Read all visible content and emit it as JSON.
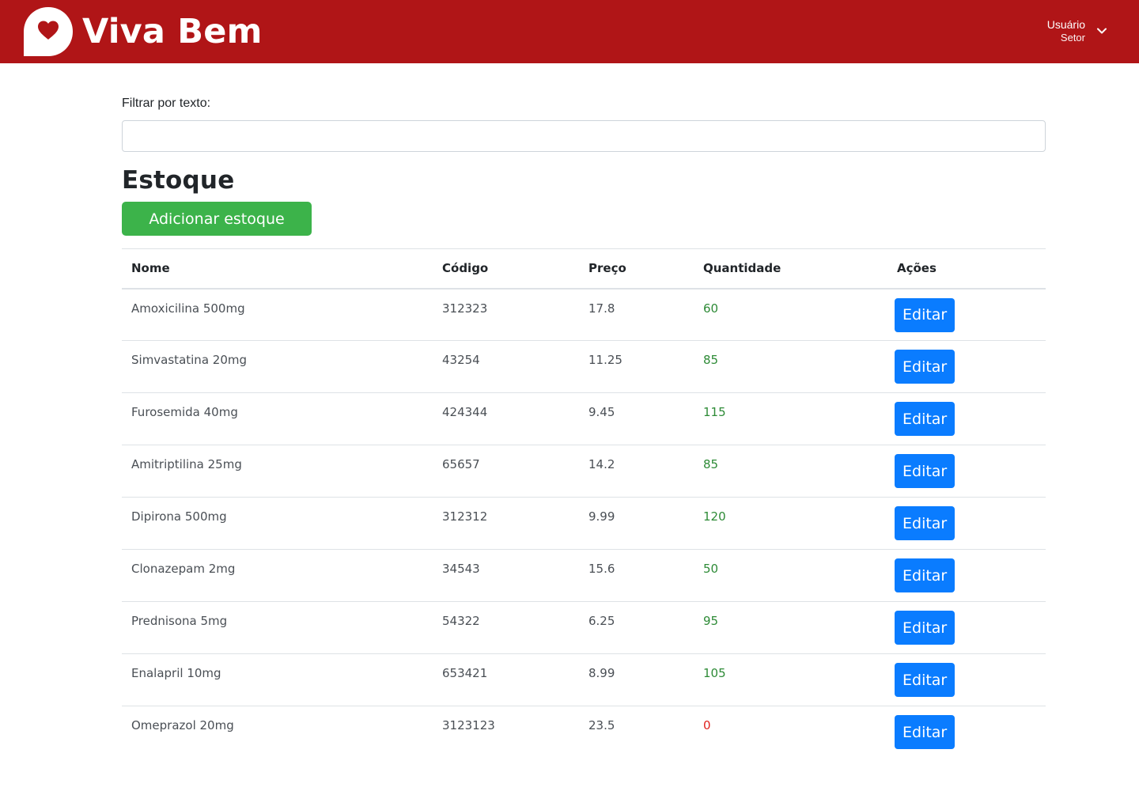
{
  "header": {
    "brand_name": "Viva Bem",
    "logo_icon": "heart-chat-icon",
    "colors": {
      "background": "#b01517",
      "text": "#ffffff"
    },
    "user": {
      "name": "Usuário",
      "sector": "Setor",
      "menu_icon": "chevron-down-icon"
    }
  },
  "filter": {
    "label": "Filtrar por texto:",
    "value": "",
    "placeholder": ""
  },
  "section": {
    "title": "Estoque",
    "add_button_label": "Adicionar estoque",
    "add_button_color": "#3cb34a"
  },
  "table": {
    "columns": [
      "Nome",
      "Código",
      "Preço",
      "Quantidade",
      "Ações"
    ],
    "edit_label": "Editar",
    "colors": {
      "in_stock": "#2e8b37",
      "out_of_stock": "#e0231f",
      "edit_button": "#0a7cff"
    },
    "rows": [
      {
        "nome": "Amoxicilina 500mg",
        "codigo": "312323",
        "preco": "17.8",
        "quantidade": "60"
      },
      {
        "nome": "Simvastatina 20mg",
        "codigo": "43254",
        "preco": "11.25",
        "quantidade": "85"
      },
      {
        "nome": "Furosemida 40mg",
        "codigo": "424344",
        "preco": "9.45",
        "quantidade": "115"
      },
      {
        "nome": "Amitriptilina 25mg",
        "codigo": "65657",
        "preco": "14.2",
        "quantidade": "85"
      },
      {
        "nome": "Dipirona 500mg",
        "codigo": "312312",
        "preco": "9.99",
        "quantidade": "120"
      },
      {
        "nome": "Clonazepam 2mg",
        "codigo": "34543",
        "preco": "15.6",
        "quantidade": "50"
      },
      {
        "nome": "Prednisona 5mg",
        "codigo": "54322",
        "preco": "6.25",
        "quantidade": "95"
      },
      {
        "nome": "Enalapril 10mg",
        "codigo": "653421",
        "preco": "8.99",
        "quantidade": "105"
      },
      {
        "nome": "Omeprazol 20mg",
        "codigo": "3123123",
        "preco": "23.5",
        "quantidade": "0"
      }
    ]
  }
}
